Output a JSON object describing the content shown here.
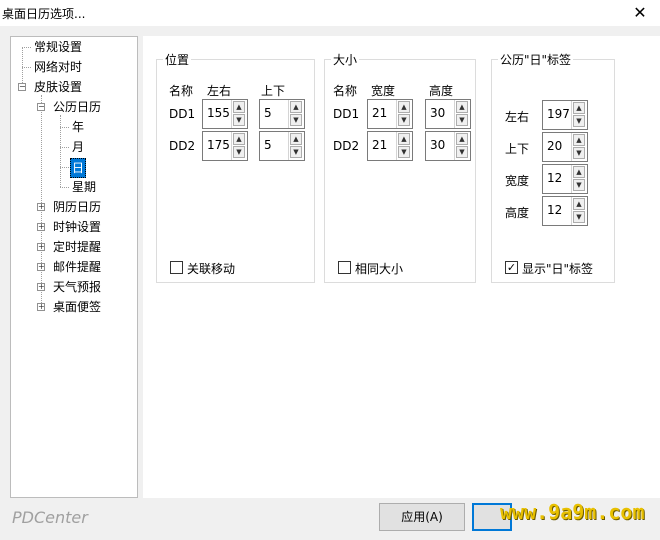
{
  "window": {
    "title": "桌面日历选项...",
    "close_glyph": "✕"
  },
  "tree": {
    "items": [
      {
        "label": "常规设置"
      },
      {
        "label": "网络对时"
      },
      {
        "label": "皮肤设置"
      },
      {
        "label": "公历日历"
      },
      {
        "label": "年"
      },
      {
        "label": "月"
      },
      {
        "label": "日"
      },
      {
        "label": "星期"
      },
      {
        "label": "阴历日历"
      },
      {
        "label": "时钟设置"
      },
      {
        "label": "定时提醒"
      },
      {
        "label": "邮件提醒"
      },
      {
        "label": "天气预报"
      },
      {
        "label": "桌面便签"
      }
    ]
  },
  "position_group": {
    "title": "位置",
    "col_name": "名称",
    "col_lr": "左右",
    "col_ud": "上下",
    "rows": [
      {
        "name": "DD1",
        "lr": "155",
        "ud": "5"
      },
      {
        "name": "DD2",
        "lr": "175",
        "ud": "5"
      }
    ],
    "checkbox": {
      "label": "关联移动",
      "checked": false
    }
  },
  "size_group": {
    "title": "大小",
    "col_name": "名称",
    "col_w": "宽度",
    "col_h": "高度",
    "rows": [
      {
        "name": "DD1",
        "w": "21",
        "h": "30"
      },
      {
        "name": "DD2",
        "w": "21",
        "h": "30"
      }
    ],
    "checkbox": {
      "label": "相同大小",
      "checked": false
    }
  },
  "label_group": {
    "title": "公历\"日\"标签",
    "fields": [
      {
        "label": "左右",
        "value": "197"
      },
      {
        "label": "上下",
        "value": "20"
      },
      {
        "label": "宽度",
        "value": "12"
      },
      {
        "label": "高度",
        "value": "12"
      }
    ],
    "checkbox": {
      "label": "显示\"日\"标签",
      "checked": true
    }
  },
  "footer": {
    "brand": "PDCenter",
    "apply_label": "应用(A)",
    "watermark": "www.9a9m.com"
  },
  "colors": {
    "accent": "#0078d7",
    "watermark": "#e8c000"
  }
}
